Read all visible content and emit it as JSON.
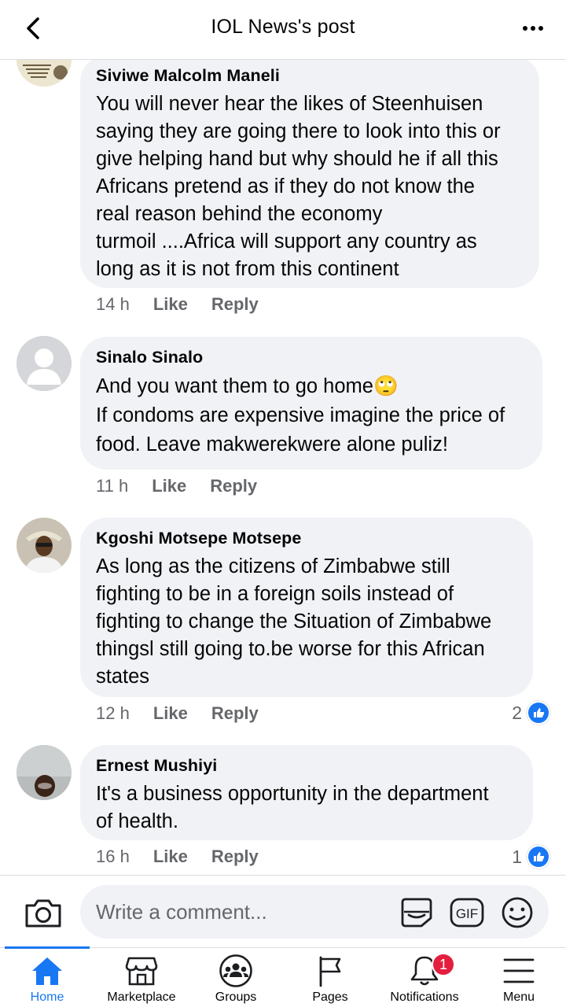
{
  "header": {
    "title": "IOL News's post"
  },
  "comments": [
    {
      "author": "Siviwe Malcolm Maneli",
      "text": "You will never hear the likes of Steenhuisen\nsaying they are going there to look into this or\ngive helping hand but why should he if all this\nAfricans pretend as if they do not know the\nreal reason behind the economy\nturmoil ....Africa will support any country as\nlong as it is not from this continent",
      "time": "14 h",
      "like": "Like",
      "reply": "Reply"
    },
    {
      "author": "Sinalo Sinalo",
      "text": "And you want them to go home🙄\nIf condoms are expensive imagine the price of\nfood. Leave makwerekwere alone puliz!",
      "time": "11 h",
      "like": "Like",
      "reply": "Reply"
    },
    {
      "author": "Kgoshi Motsepe Motsepe",
      "text": "As long as the citizens of Zimbabwe still\nfighting to be in a foreign soils instead of\nfighting to change the Situation of Zimbabwe\nthingsl still going to.be worse for this African\nstates",
      "time": "12 h",
      "like": "Like",
      "reply": "Reply",
      "reactions": "2"
    },
    {
      "author": "Ernest Mushiyi",
      "text": "It's a business opportunity in the department\nof health.",
      "time": "16 h",
      "like": "Like",
      "reply": "Reply",
      "reactions": "1"
    }
  ],
  "composer": {
    "placeholder": "Write a comment..."
  },
  "nav": {
    "home": "Home",
    "marketplace": "Marketplace",
    "groups": "Groups",
    "pages": "Pages",
    "notifications": "Notifications",
    "notifications_count": "1",
    "menu": "Menu"
  },
  "colors": {
    "accent": "#1877f2",
    "bubble": "#f0f2f5",
    "badge": "#e41e3f",
    "muted": "#65676b"
  },
  "icons": [
    "back-arrow-icon",
    "more-icon",
    "camera-icon",
    "sticker-icon",
    "gif-icon",
    "emoji-icon",
    "home-icon",
    "marketplace-icon",
    "groups-icon",
    "pages-icon",
    "notifications-icon",
    "menu-icon",
    "like-thumb-icon"
  ]
}
